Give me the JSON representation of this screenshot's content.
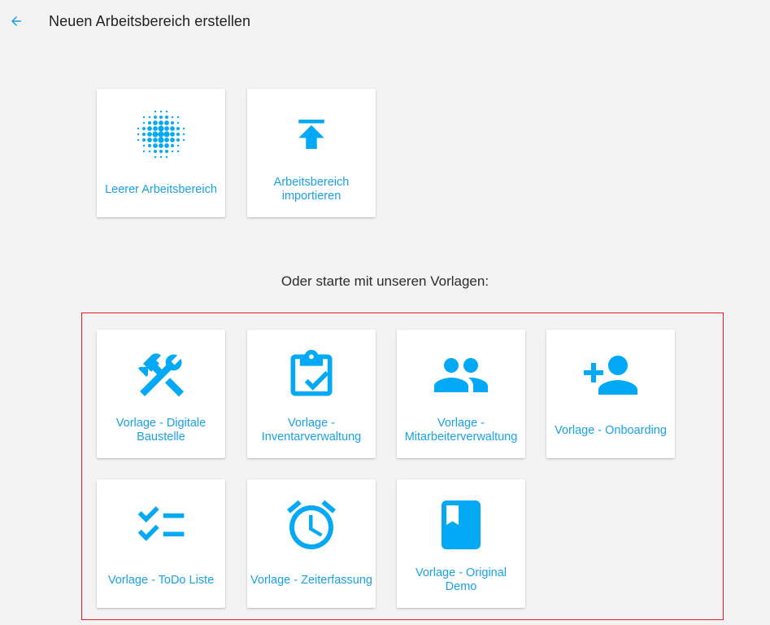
{
  "header": {
    "back_icon": "arrow-left-icon",
    "title": "Neuen Arbeitsbereich erstellen"
  },
  "accent_color": "#03a9f4",
  "start_options": [
    {
      "label": "Leerer Arbeitsbereich",
      "icon": "blank-grid-icon"
    },
    {
      "label": "Arbeitsbereich importieren",
      "icon": "upload-icon"
    }
  ],
  "templates_heading": "Oder starte mit unseren Vorlagen:",
  "templates": [
    {
      "label": "Vorlage - Digitale Baustelle",
      "icon": "construction-tools-icon"
    },
    {
      "label": "Vorlage - Inventarverwaltung",
      "icon": "clipboard-check-icon"
    },
    {
      "label": "Vorlage - Mitarbeiterverwaltung",
      "icon": "people-icon"
    },
    {
      "label": "Vorlage - Onboarding",
      "icon": "person-add-icon"
    },
    {
      "label": "Vorlage - ToDo Liste",
      "icon": "checklist-icon"
    },
    {
      "label": "Vorlage - Zeiterfassung",
      "icon": "alarm-clock-icon"
    },
    {
      "label": "Vorlage - Original Demo",
      "icon": "book-icon"
    }
  ]
}
